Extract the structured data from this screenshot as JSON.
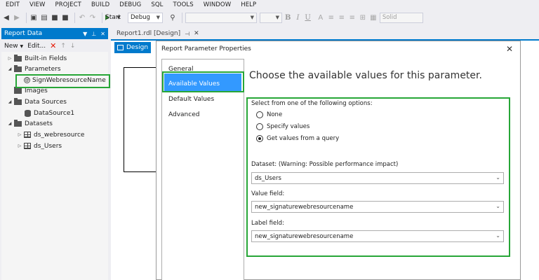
{
  "menubar": {
    "items": [
      "EDIT",
      "VIEW",
      "PROJECT",
      "BUILD",
      "DEBUG",
      "SQL",
      "TOOLS",
      "WINDOW",
      "HELP"
    ]
  },
  "toolbar": {
    "start_label": "Start",
    "config_value": "Debug",
    "line_style_value": "Solid",
    "format_buttons": [
      "B",
      "I",
      "U"
    ]
  },
  "report_data": {
    "title": "Report Data",
    "new_label": "New",
    "edit_label": "Edit...",
    "tree": [
      {
        "label": "Built-in Fields"
      },
      {
        "label": "Parameters"
      },
      {
        "label": "SignWebresourceName"
      },
      {
        "label": "Images"
      },
      {
        "label": "Data Sources"
      },
      {
        "label": "DataSource1"
      },
      {
        "label": "Datasets"
      },
      {
        "label": "ds_webresource"
      },
      {
        "label": "ds_Users"
      }
    ]
  },
  "document": {
    "tab_label": "Report1.rdl [Design]",
    "design_button": "Design"
  },
  "dialog": {
    "title": "Report Parameter Properties",
    "nav": [
      "General",
      "Available Values",
      "Default Values",
      "Advanced"
    ],
    "heading": "Choose the available values for this parameter.",
    "options_label": "Select from one of the following options:",
    "options": [
      {
        "label": "None",
        "selected": false
      },
      {
        "label": "Specify values",
        "selected": false
      },
      {
        "label": "Get values from a query",
        "selected": true
      }
    ],
    "dataset_label": "Dataset: (Warning: Possible performance impact)",
    "dataset_value": "ds_Users",
    "value_field_label": "Value field:",
    "value_field_value": "new_signaturewebresourcename",
    "label_field_label": "Label field:",
    "label_field_value": "new_signaturewebresourcename"
  },
  "colors": {
    "accent": "#007acc",
    "highlight": "#27a637",
    "selection": "#3399ff"
  }
}
